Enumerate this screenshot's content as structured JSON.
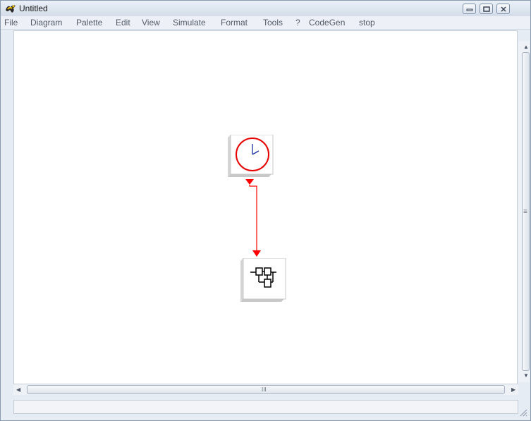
{
  "window": {
    "title": "Untitled",
    "icon": "scilab-app-icon",
    "controls": [
      "minimize-icon",
      "maximize-icon",
      "close-icon"
    ]
  },
  "menu": {
    "items": [
      "File",
      "Diagram",
      "Palette",
      "Edit",
      "View",
      "Simulate",
      "Format",
      "Tools",
      "?",
      "CodeGen",
      "stop"
    ]
  },
  "diagram": {
    "blocks": [
      {
        "name": "clock-block",
        "icon": "clock-icon"
      },
      {
        "name": "scope-block",
        "icon": "scope-icon"
      }
    ],
    "link_color": "#ff0000",
    "clock_face_color": "#e60000",
    "clock_hand_color": "#1a2ea0"
  },
  "scrollbars": {
    "vertical_grip": "≡",
    "horizontal_grip": "III"
  },
  "status": {
    "text": ""
  }
}
